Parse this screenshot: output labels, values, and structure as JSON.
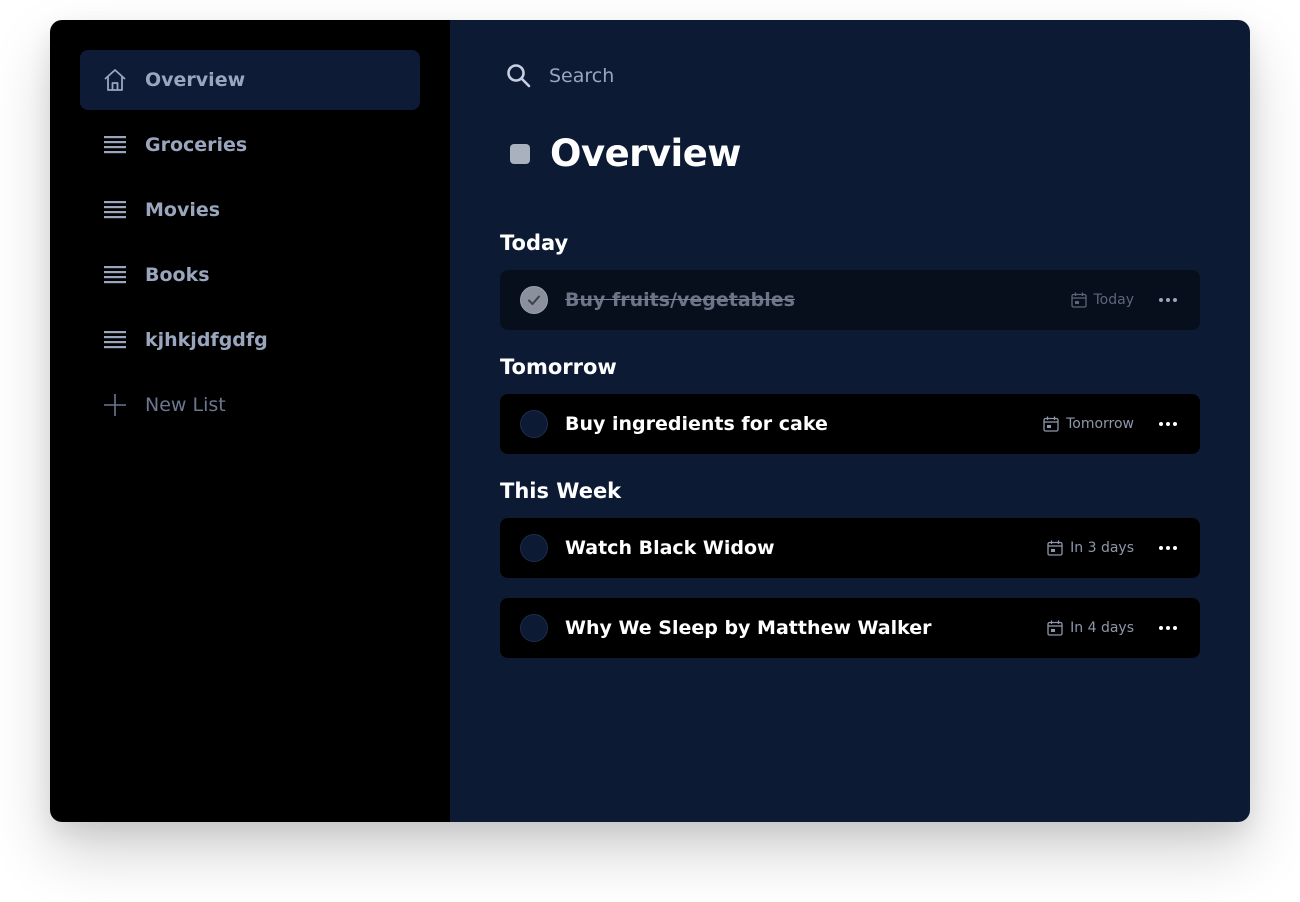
{
  "sidebar": {
    "items": [
      {
        "label": "Overview",
        "icon": "home-icon",
        "active": true
      },
      {
        "label": "Groceries",
        "icon": "list-icon"
      },
      {
        "label": "Movies",
        "icon": "list-icon"
      },
      {
        "label": "Books",
        "icon": "list-icon"
      },
      {
        "label": "kjhkjdfgdfg",
        "icon": "list-icon"
      }
    ],
    "new_list_label": "New List"
  },
  "search": {
    "placeholder": "Search"
  },
  "page": {
    "title": "Overview"
  },
  "sections": [
    {
      "title": "Today",
      "tasks": [
        {
          "title": "Buy fruits/vegetables",
          "due": "Today",
          "done": true
        }
      ]
    },
    {
      "title": "Tomorrow",
      "tasks": [
        {
          "title": "Buy ingredients for cake",
          "due": "Tomorrow",
          "done": false
        }
      ]
    },
    {
      "title": "This Week",
      "tasks": [
        {
          "title": "Watch Black Widow",
          "due": "In 3 days",
          "done": false
        },
        {
          "title": "Why We Sleep by Matthew Walker",
          "due": "In 4 days",
          "done": false
        }
      ]
    }
  ],
  "colors": {
    "sidebar_bg": "#000000",
    "main_bg": "#0c1a33",
    "active_item_bg": "#0d1b36",
    "text_primary": "#ffffff",
    "text_secondary": "#9aa6bd"
  }
}
